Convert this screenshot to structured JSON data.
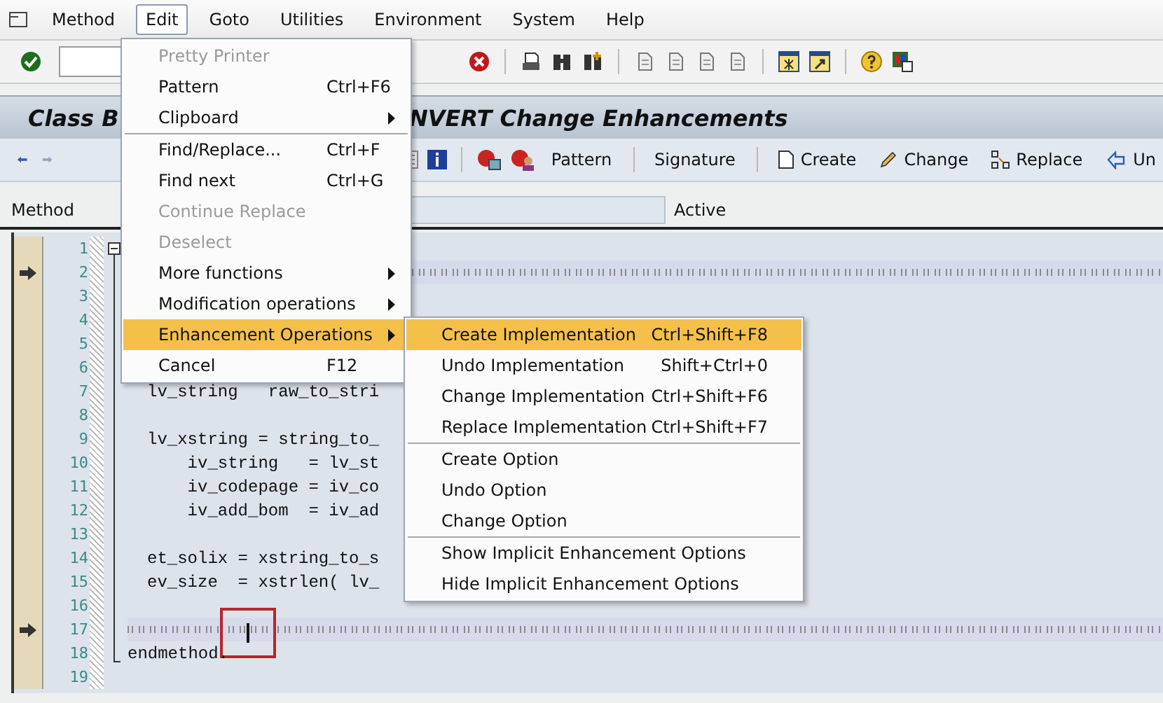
{
  "menu_bar": [
    {
      "label": "Method",
      "selected": false
    },
    {
      "label": "Edit",
      "selected": true
    },
    {
      "label": "Goto",
      "selected": false
    },
    {
      "label": "Utilities",
      "selected": false
    },
    {
      "label": "Environment",
      "selected": false
    },
    {
      "label": "System",
      "selected": false
    },
    {
      "label": "Help",
      "selected": false
    }
  ],
  "title_parts": [
    "Class B",
    "NVERT Change Enhancements"
  ],
  "app_toolbar": [
    {
      "label": "Pattern",
      "kind": "text"
    },
    {
      "label": "Signature",
      "kind": "text"
    },
    {
      "label": "Create",
      "kind": "create"
    },
    {
      "label": "Change",
      "kind": "change"
    },
    {
      "label": "Replace",
      "kind": "replace"
    },
    {
      "label": "Un",
      "kind": "undo"
    }
  ],
  "method_row": {
    "label": "Method",
    "status": "Active"
  },
  "editor_lines": [
    {
      "number": "1",
      "kind": "blank",
      "arrow": false
    },
    {
      "number": "2",
      "kind": "marker",
      "arrow": true
    },
    {
      "number": "3",
      "kind": "blank",
      "arrow": false
    },
    {
      "number": "4",
      "kind": "blank",
      "arrow": false
    },
    {
      "number": "5",
      "kind": "blank",
      "arrow": false
    },
    {
      "number": "6",
      "kind": "blank",
      "arrow": false
    },
    {
      "number": "7",
      "kind": "code",
      "text": "lv_string   raw_to_stri",
      "arrow": false
    },
    {
      "number": "8",
      "kind": "blank",
      "arrow": false
    },
    {
      "number": "9",
      "kind": "code",
      "text": "lv_xstring = string_to_",
      "arrow": false
    },
    {
      "number": "10",
      "kind": "code",
      "text": "    iv_string   = lv_st",
      "arrow": false
    },
    {
      "number": "11",
      "kind": "code",
      "text": "    iv_codepage = iv_co",
      "arrow": false
    },
    {
      "number": "12",
      "kind": "code",
      "text": "    iv_add_bom  = iv_ad",
      "arrow": false
    },
    {
      "number": "13",
      "kind": "blank",
      "arrow": false
    },
    {
      "number": "14",
      "kind": "code",
      "text": "et_solix = xstring_to_s",
      "arrow": false
    },
    {
      "number": "15",
      "kind": "code",
      "text": "ev_size  = xstrlen( lv_",
      "arrow": false
    },
    {
      "number": "16",
      "kind": "blank",
      "arrow": false
    },
    {
      "number": "17",
      "kind": "marker",
      "arrow": true,
      "cursor": true
    },
    {
      "number": "18",
      "kind": "end",
      "text": "endmethod.",
      "arrow": false
    },
    {
      "number": "19",
      "kind": "blank",
      "arrow": false
    }
  ],
  "edit_menu": [
    {
      "kind": "item",
      "label": "Pretty Printer",
      "disabled": true,
      "selected": false,
      "submenu": false
    },
    {
      "kind": "item",
      "label": "Pattern",
      "shortcut": "Ctrl+F6",
      "disabled": false,
      "selected": false,
      "submenu": false
    },
    {
      "kind": "item",
      "label": "Clipboard",
      "disabled": false,
      "selected": false,
      "submenu": true
    },
    {
      "kind": "separator"
    },
    {
      "kind": "item",
      "label": "Find/Replace...",
      "shortcut": "Ctrl+F",
      "disabled": false,
      "selected": false,
      "submenu": false
    },
    {
      "kind": "item",
      "label": "Find next",
      "shortcut": "Ctrl+G",
      "disabled": false,
      "selected": false,
      "submenu": false
    },
    {
      "kind": "item",
      "label": "Continue Replace",
      "disabled": true,
      "selected": false,
      "submenu": false
    },
    {
      "kind": "item",
      "label": "Deselect",
      "disabled": true,
      "selected": false,
      "submenu": false
    },
    {
      "kind": "item",
      "label": "More functions",
      "disabled": false,
      "selected": false,
      "submenu": true
    },
    {
      "kind": "item",
      "label": "Modification operations",
      "disabled": false,
      "selected": false,
      "submenu": true
    },
    {
      "kind": "item",
      "label": "Enhancement Operations",
      "disabled": false,
      "selected": true,
      "submenu": true
    },
    {
      "kind": "item",
      "label": "Cancel",
      "shortcut": "F12",
      "disabled": false,
      "selected": false,
      "submenu": false
    }
  ],
  "enhancement_submenu": [
    {
      "kind": "item",
      "label": "Create Implementation",
      "shortcut": "Ctrl+Shift+F8",
      "selected": true
    },
    {
      "kind": "item",
      "label": "Undo Implementation",
      "shortcut": "Shift+Ctrl+0",
      "selected": false
    },
    {
      "kind": "item",
      "label": "Change Implementation",
      "shortcut": "Ctrl+Shift+F6",
      "selected": false
    },
    {
      "kind": "item",
      "label": "Replace Implementation",
      "shortcut": "Ctrl+Shift+F7",
      "selected": false
    },
    {
      "kind": "separator"
    },
    {
      "kind": "item",
      "label": "Create Option",
      "selected": false
    },
    {
      "kind": "item",
      "label": "Undo Option",
      "selected": false
    },
    {
      "kind": "item",
      "label": "Change Option",
      "selected": false
    },
    {
      "kind": "separator"
    },
    {
      "kind": "item",
      "label": "Show Implicit Enhancement Options",
      "selected": false
    },
    {
      "kind": "item",
      "label": "Hide Implicit Enhancement Options",
      "selected": false
    }
  ]
}
